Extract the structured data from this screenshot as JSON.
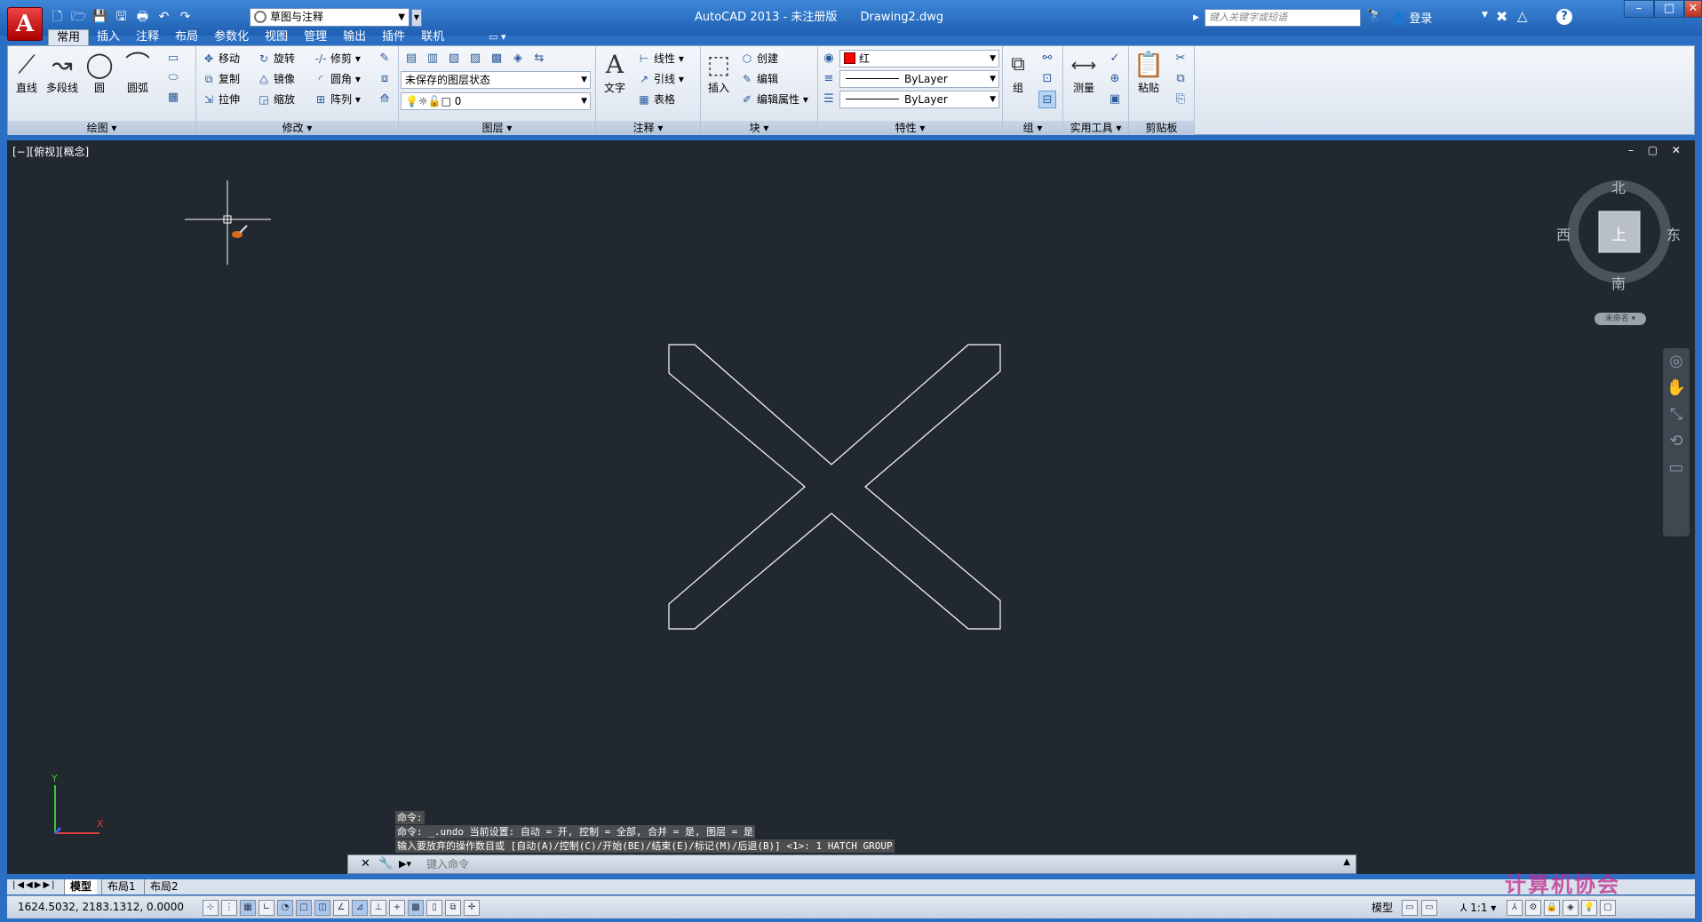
{
  "app": {
    "logo": "A",
    "title": "AutoCAD 2013 - 未注册版",
    "doc": "Drawing2.dwg",
    "workspace": "草图与注释",
    "search_placeholder": "键入关键字或短语",
    "login": "登录",
    "help": "?",
    "win": {
      "min": "–",
      "max": "□",
      "close": "✕"
    }
  },
  "qat": [
    "🗋",
    "🗁",
    "💾",
    "🖫",
    "🖶",
    "↶",
    "↷"
  ],
  "tabs": [
    "常用",
    "插入",
    "注释",
    "布局",
    "参数化",
    "视图",
    "管理",
    "输出",
    "插件",
    "联机"
  ],
  "ribbon": {
    "draw": {
      "title": "绘图 ▾",
      "line": "直线",
      "polyline": "多段线",
      "circle": "圆",
      "arc": "圆弧"
    },
    "modify": {
      "title": "修改 ▾",
      "move": "移动",
      "rotate": "旋转",
      "trim": "修剪",
      "copy": "复制",
      "mirror": "镜像",
      "fillet": "圆角",
      "stretch": "拉伸",
      "scale": "缩放",
      "array": "阵列"
    },
    "layers": {
      "title": "图层 ▾",
      "state": "未保存的图层状态",
      "current": "0"
    },
    "annotation": {
      "title": "注释 ▾",
      "text": "文字",
      "linear": "线性",
      "leader": "引线",
      "table": "表格"
    },
    "block": {
      "title": "块 ▾",
      "insert": "插入",
      "create": "创建",
      "edit": "编辑",
      "edit_attr": "编辑属性"
    },
    "properties": {
      "title": "特性 ▾",
      "color": "红",
      "linetype": "ByLayer",
      "lineweight": "ByLayer",
      "color_hex": "#ff0000"
    },
    "groups": {
      "title": "组 ▾",
      "group": "组"
    },
    "utilities": {
      "title": "实用工具 ▾",
      "measure": "测量"
    },
    "clipboard": {
      "title": "剪贴板",
      "paste": "粘贴"
    }
  },
  "canvas": {
    "view_label": "[−][俯视][概念]",
    "viewcube": {
      "n": "北",
      "s": "南",
      "e": "东",
      "w": "西",
      "face": "上",
      "wcs": "未命名 ▾"
    },
    "ucs": {
      "x": "X",
      "y": "Y"
    },
    "cmd_history": [
      "命令:",
      "命令: _.undo 当前设置: 自动 = 开, 控制 = 全部, 合并 = 是, 图层 = 是",
      "输入要放弃的操作数目或 [自动(A)/控制(C)/开始(BE)/结束(E)/标记(M)/后退(B)] <1>: 1 HATCH GROUP"
    ],
    "cmd_placeholder": "键入命令"
  },
  "layout_tabs": [
    "模型",
    "布局1",
    "布局2"
  ],
  "status": {
    "coords": "1624.5032, 2183.1312, 0.0000",
    "model": "模型",
    "scale": "1:1 ▾"
  },
  "watermark": "计算机协会"
}
